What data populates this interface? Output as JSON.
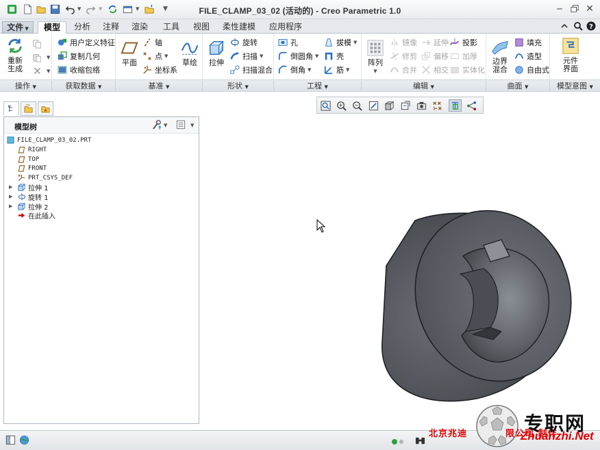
{
  "window": {
    "title": "FILE_CLAMP_03_02 (活动的) - Creo Parametric 1.0"
  },
  "tabs": [
    {
      "label": "文件",
      "dropdown": true
    },
    {
      "label": "模型",
      "active": true
    },
    {
      "label": "分析"
    },
    {
      "label": "注释"
    },
    {
      "label": "渲染"
    },
    {
      "label": "工具"
    },
    {
      "label": "视图"
    },
    {
      "label": "柔性建模"
    },
    {
      "label": "应用程序"
    }
  ],
  "ribbon": {
    "operations": {
      "regenerate": "重新生成"
    },
    "get_data": {
      "user_defined_feature": "用户定义特征",
      "copy_geometry": "复制几何",
      "shrinkwrap": "收缩包络"
    },
    "datum": {
      "plane": "平面",
      "axis": "轴",
      "point": "点",
      "csys": "坐标系",
      "sketch": "草绘"
    },
    "shapes": {
      "extrude": "拉伸",
      "revolve": "旋转",
      "sweep": "扫描",
      "swept_blend": "扫描混合"
    },
    "engineering": {
      "hole": "孔",
      "round": "倒圆角",
      "chamfer": "倒角",
      "draft": "拔模",
      "shell": "壳",
      "rib": "筋"
    },
    "editing": {
      "pattern": "阵列",
      "mirror": "镜像",
      "trim": "修剪",
      "merge": "合并",
      "extend": "延伸",
      "offset": "偏移",
      "intersect": "相交",
      "project": "投影",
      "thicken": "加厚",
      "solidify": "实体化"
    },
    "surfaces": {
      "boundary_blend": "边界混合",
      "fill": "填充",
      "style": "造型",
      "freestyle": "自由式"
    },
    "model_intent": {
      "component_interface": "元件界面"
    }
  },
  "group_labels": [
    "操作",
    "获取数据",
    "基准",
    "形状",
    "工程",
    "编辑",
    "曲面",
    "模型意图"
  ],
  "model_tree": {
    "title": "模型树",
    "root": "FILE_CLAMP_03_02.PRT",
    "items": [
      {
        "label": "RIGHT",
        "icon": "datum-plane-icon",
        "expandable": false
      },
      {
        "label": "TOP",
        "icon": "datum-plane-icon",
        "expandable": false
      },
      {
        "label": "FRONT",
        "icon": "datum-plane-icon",
        "expandable": false
      },
      {
        "label": "PRT_CSYS_DEF",
        "icon": "csys-icon",
        "expandable": false
      },
      {
        "label": "拉伸 1",
        "icon": "extrude-icon",
        "expandable": true
      },
      {
        "label": "旋转 1",
        "icon": "revolve-icon",
        "expandable": true
      },
      {
        "label": "拉伸 2",
        "icon": "extrude-icon",
        "expandable": true
      },
      {
        "label": "在此插入",
        "icon": "insert-here-icon",
        "expandable": false
      }
    ]
  },
  "watermark": {
    "company": "北京兆迪",
    "company_tail": "限公司 制作",
    "site": "专职网",
    "url": "Zhuanzhi.Net"
  },
  "colors": {
    "accent_green": "#2f9e44",
    "model_gray": "#55595f",
    "watermark_red": "#e10000"
  }
}
